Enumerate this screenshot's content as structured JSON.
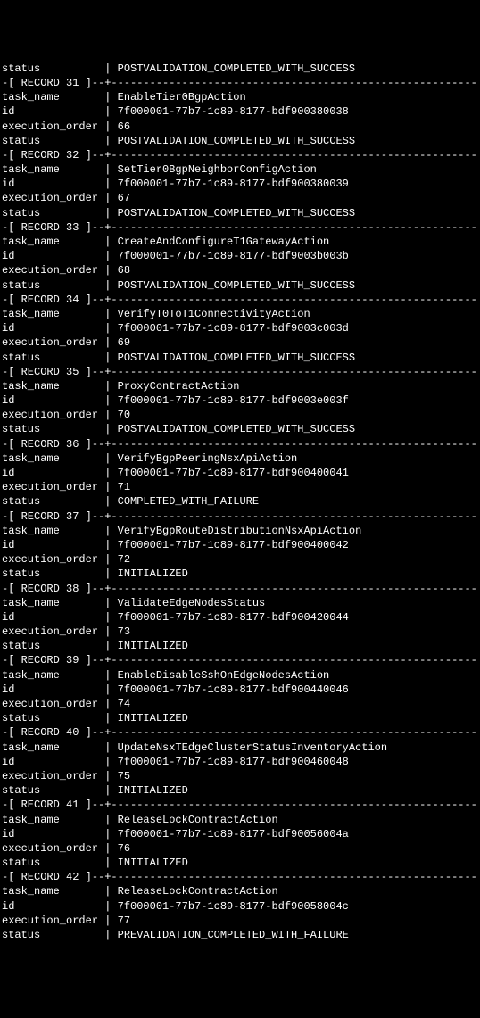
{
  "label_width": 15,
  "divider_width": 74,
  "top": [
    {
      "label": "status",
      "value": "POSTVALIDATION_COMPLETED_WITH_SUCCESS"
    }
  ],
  "records": [
    {
      "num": 31,
      "rows": [
        {
          "label": "task_name",
          "value": "EnableTier0BgpAction"
        },
        {
          "label": "id",
          "value": "7f000001-77b7-1c89-8177-bdf900380038"
        },
        {
          "label": "execution_order",
          "value": "66"
        },
        {
          "label": "status",
          "value": "POSTVALIDATION_COMPLETED_WITH_SUCCESS"
        }
      ]
    },
    {
      "num": 32,
      "rows": [
        {
          "label": "task_name",
          "value": "SetTier0BgpNeighborConfigAction"
        },
        {
          "label": "id",
          "value": "7f000001-77b7-1c89-8177-bdf900380039"
        },
        {
          "label": "execution_order",
          "value": "67"
        },
        {
          "label": "status",
          "value": "POSTVALIDATION_COMPLETED_WITH_SUCCESS"
        }
      ]
    },
    {
      "num": 33,
      "rows": [
        {
          "label": "task_name",
          "value": "CreateAndConfigureT1GatewayAction"
        },
        {
          "label": "id",
          "value": "7f000001-77b7-1c89-8177-bdf9003b003b"
        },
        {
          "label": "execution_order",
          "value": "68"
        },
        {
          "label": "status",
          "value": "POSTVALIDATION_COMPLETED_WITH_SUCCESS"
        }
      ]
    },
    {
      "num": 34,
      "rows": [
        {
          "label": "task_name",
          "value": "VerifyT0ToT1ConnectivityAction"
        },
        {
          "label": "id",
          "value": "7f000001-77b7-1c89-8177-bdf9003c003d"
        },
        {
          "label": "execution_order",
          "value": "69"
        },
        {
          "label": "status",
          "value": "POSTVALIDATION_COMPLETED_WITH_SUCCESS"
        }
      ]
    },
    {
      "num": 35,
      "rows": [
        {
          "label": "task_name",
          "value": "ProxyContractAction"
        },
        {
          "label": "id",
          "value": "7f000001-77b7-1c89-8177-bdf9003e003f"
        },
        {
          "label": "execution_order",
          "value": "70"
        },
        {
          "label": "status",
          "value": "POSTVALIDATION_COMPLETED_WITH_SUCCESS"
        }
      ]
    },
    {
      "num": 36,
      "rows": [
        {
          "label": "task_name",
          "value": "VerifyBgpPeeringNsxApiAction"
        },
        {
          "label": "id",
          "value": "7f000001-77b7-1c89-8177-bdf900400041"
        },
        {
          "label": "execution_order",
          "value": "71"
        },
        {
          "label": "status",
          "value": "COMPLETED_WITH_FAILURE"
        }
      ]
    },
    {
      "num": 37,
      "rows": [
        {
          "label": "task_name",
          "value": "VerifyBgpRouteDistributionNsxApiAction"
        },
        {
          "label": "id",
          "value": "7f000001-77b7-1c89-8177-bdf900400042"
        },
        {
          "label": "execution_order",
          "value": "72"
        },
        {
          "label": "status",
          "value": "INITIALIZED"
        }
      ]
    },
    {
      "num": 38,
      "rows": [
        {
          "label": "task_name",
          "value": "ValidateEdgeNodesStatus"
        },
        {
          "label": "id",
          "value": "7f000001-77b7-1c89-8177-bdf900420044"
        },
        {
          "label": "execution_order",
          "value": "73"
        },
        {
          "label": "status",
          "value": "INITIALIZED"
        }
      ]
    },
    {
      "num": 39,
      "rows": [
        {
          "label": "task_name",
          "value": "EnableDisableSshOnEdgeNodesAction"
        },
        {
          "label": "id",
          "value": "7f000001-77b7-1c89-8177-bdf900440046"
        },
        {
          "label": "execution_order",
          "value": "74"
        },
        {
          "label": "status",
          "value": "INITIALIZED"
        }
      ]
    },
    {
      "num": 40,
      "rows": [
        {
          "label": "task_name",
          "value": "UpdateNsxTEdgeClusterStatusInventoryAction"
        },
        {
          "label": "id",
          "value": "7f000001-77b7-1c89-8177-bdf900460048"
        },
        {
          "label": "execution_order",
          "value": "75"
        },
        {
          "label": "status",
          "value": "INITIALIZED"
        }
      ]
    },
    {
      "num": 41,
      "rows": [
        {
          "label": "task_name",
          "value": "ReleaseLockContractAction"
        },
        {
          "label": "id",
          "value": "7f000001-77b7-1c89-8177-bdf90056004a"
        },
        {
          "label": "execution_order",
          "value": "76"
        },
        {
          "label": "status",
          "value": "INITIALIZED"
        }
      ]
    },
    {
      "num": 42,
      "rows": [
        {
          "label": "task_name",
          "value": "ReleaseLockContractAction"
        },
        {
          "label": "id",
          "value": "7f000001-77b7-1c89-8177-bdf90058004c"
        },
        {
          "label": "execution_order",
          "value": "77"
        },
        {
          "label": "status",
          "value": "PREVALIDATION_COMPLETED_WITH_FAILURE"
        }
      ]
    }
  ]
}
